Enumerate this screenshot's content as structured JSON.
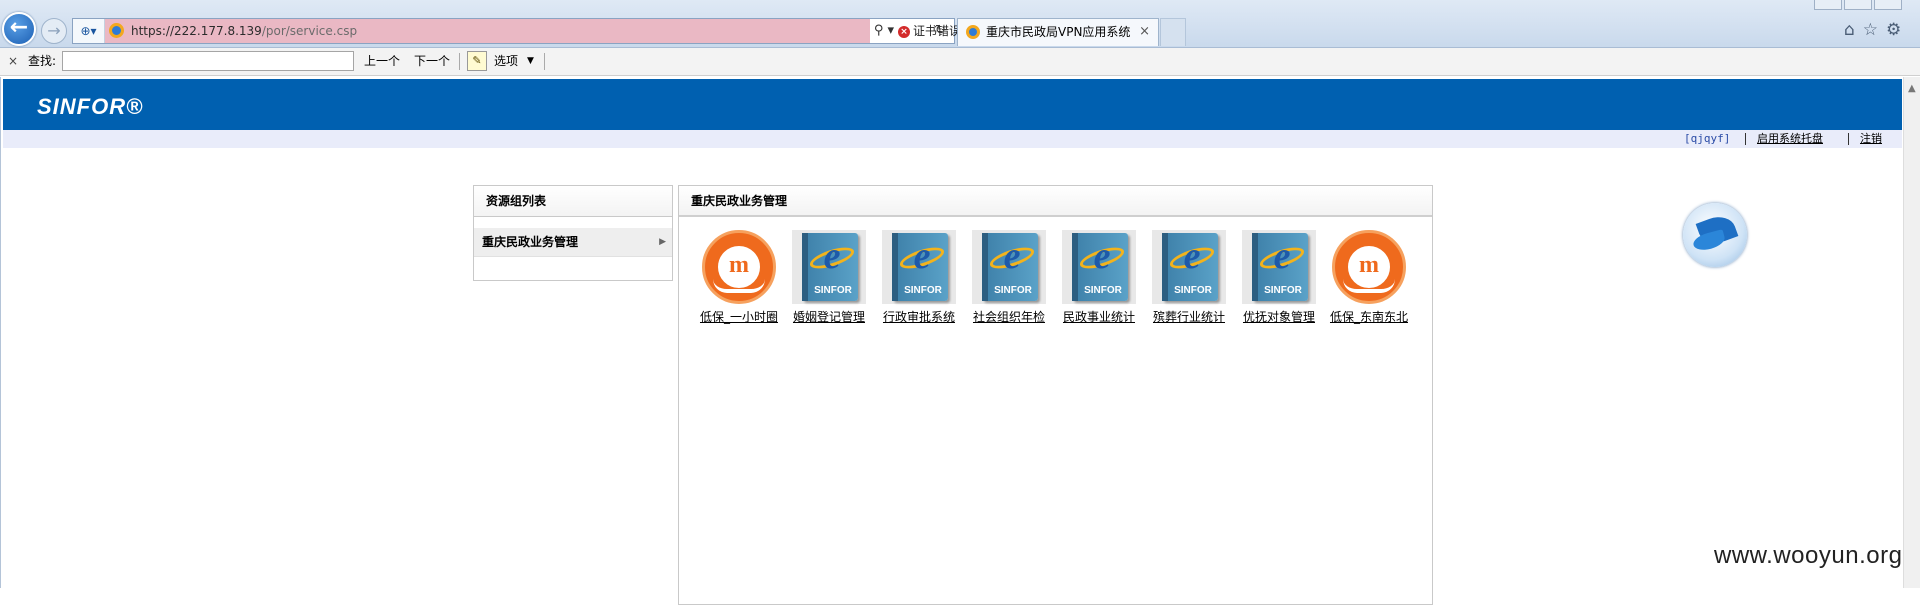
{
  "browser": {
    "back_glyph": "←",
    "forward_glyph": "→",
    "url_host": "https://222.177.8.139",
    "url_path": "/por/service.csp",
    "search_glyph": "⚲ ▾",
    "cert_error": "证书错误",
    "refresh_glyph": "↻",
    "tab_title": "重庆市民政局VPN应用系统",
    "tab_close": "×",
    "right_icons": "⌂☆⚙"
  },
  "findbar": {
    "close": "×",
    "label": "查找:",
    "input_value": "",
    "prev": "上一个",
    "next": "下一个",
    "options": "选项",
    "options_arrow": "▼"
  },
  "header": {
    "logo": "SINFOR®",
    "username": "[qjqyf]",
    "tray_link": "启用系统托盘",
    "logout_link": "注销"
  },
  "left_panel": {
    "title": "资源组列表",
    "items": [
      {
        "label": "重庆民政业务管理"
      }
    ]
  },
  "main_panel": {
    "title": "重庆民政业务管理",
    "apps": [
      {
        "label": "低保_一小时圈",
        "icon": "civil-affairs-logo-icon"
      },
      {
        "label": "婚姻登记管理",
        "icon": "ie-sinfor-icon"
      },
      {
        "label": "行政审批系统",
        "icon": "ie-sinfor-icon"
      },
      {
        "label": "社会组织年检",
        "icon": "ie-sinfor-icon"
      },
      {
        "label": "民政事业统计",
        "icon": "ie-sinfor-icon"
      },
      {
        "label": "殡葬行业统计",
        "icon": "ie-sinfor-icon"
      },
      {
        "label": "优抚对象管理",
        "icon": "ie-sinfor-icon"
      },
      {
        "label": "低保_东南东北",
        "icon": "civil-affairs-logo-icon"
      }
    ],
    "ie_brand_text": "SINFOR"
  },
  "watermark": "www.wooyun.org",
  "colors": {
    "header_blue": "#0060b0",
    "userbar_bg": "#e9ecfa",
    "url_error_bg": "#eab8c4",
    "civil_orange": "#ef6a1d"
  }
}
